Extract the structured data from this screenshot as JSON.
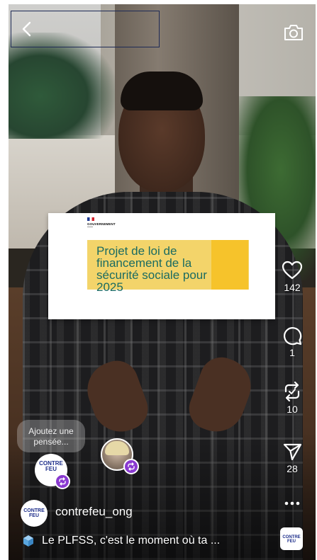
{
  "card": {
    "org": "GOUVERNEMENT",
    "headline": "Projet de loi de financement de la sécurité sociale pour 2025"
  },
  "rail": {
    "likes": "142",
    "comments": "1",
    "reposts": "10",
    "shares": "28"
  },
  "thought_bubble": {
    "placeholder": "Ajoutez une pensée..."
  },
  "account": {
    "username": "contrefeu_ong",
    "logo_text": "CONTRE FEU"
  },
  "caption": {
    "text": "Le PLFSS, c'est le moment où ta ..."
  },
  "icons": {
    "back": "chevron-left-icon",
    "camera": "camera-icon",
    "like": "heart-icon",
    "comment": "comment-icon",
    "repost": "repost-icon",
    "share": "send-icon",
    "more": "more-icon",
    "caption": "cube-icon"
  },
  "colors": {
    "card_text": "#1b6b61",
    "card_yellow": "#f3d46a",
    "badge": "#8a3ad0"
  }
}
